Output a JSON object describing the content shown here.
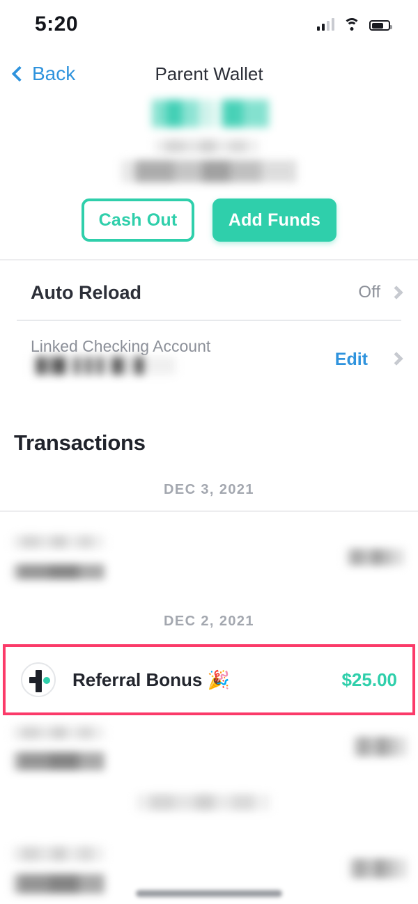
{
  "status_bar": {
    "time": "5:20",
    "signal_icon": "cellular-signal-icon",
    "wifi_icon": "wifi-icon",
    "battery_icon": "battery-icon"
  },
  "nav": {
    "back_label": "Back",
    "back_icon": "chevron-left-icon",
    "title": "Parent Wallet",
    "back_color": "#2F93DD"
  },
  "balance": {
    "amount_redacted": true,
    "subtitle_redacted": true,
    "detail_redacted": true
  },
  "actions": {
    "cash_out_label": "Cash Out",
    "add_funds_label": "Add Funds",
    "accent_color": "#2FCFAB"
  },
  "auto_reload": {
    "label": "Auto Reload",
    "value": "Off",
    "chevron_icon": "chevron-right-icon"
  },
  "linked_account": {
    "label": "Linked Checking Account",
    "account_redacted": true,
    "edit_label": "Edit",
    "chevron_icon": "chevron-right-icon"
  },
  "transactions": {
    "heading": "Transactions",
    "groups": [
      {
        "date": "DEC 3, 2021",
        "items": [
          {
            "title_redacted": true,
            "amount_redacted": true
          }
        ]
      },
      {
        "date": "DEC 2, 2021",
        "items": [
          {
            "highlighted": true,
            "highlight_color": "#FB3A69",
            "icon": "brand-logo-avatar",
            "title": "Referral Bonus 🎉",
            "amount": "$25.00",
            "amount_color": "#2FCFAB"
          },
          {
            "title_redacted": true,
            "amount_redacted": true
          }
        ]
      },
      {
        "date_redacted": true,
        "items": [
          {
            "title_redacted": true,
            "amount_redacted": true
          }
        ]
      }
    ]
  }
}
